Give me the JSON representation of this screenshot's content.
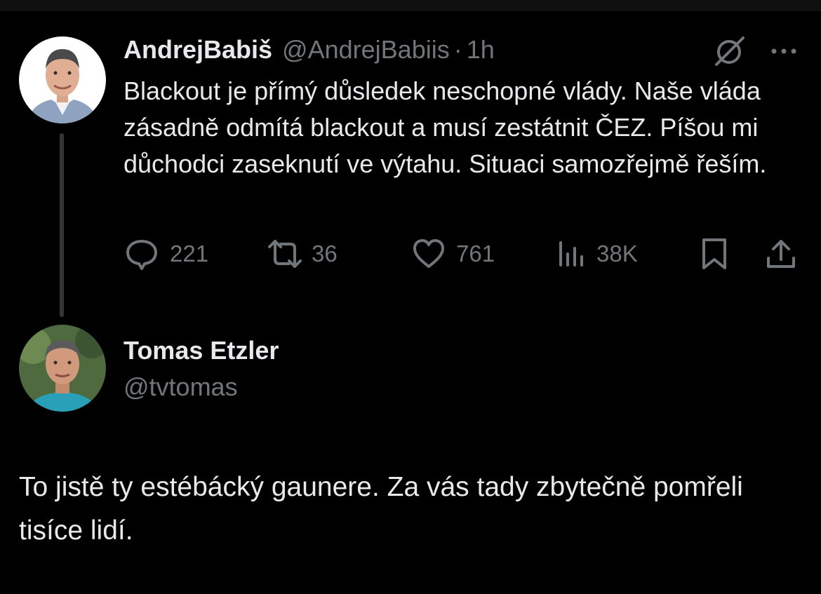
{
  "tweet": {
    "author_name": "AndrejBabiš",
    "author_handle": "@AndrejBabiis",
    "separator": "·",
    "time": "1h",
    "text": "Blackout je přímý důsledek neschopné vlády. Naše vláda zásadně odmítá blackout a musí zestátnit ČEZ. Píšou mi důchodci zaseknutí ve výtahu. Situaci samozřejmě řeším.",
    "stats": {
      "replies": "221",
      "reposts": "36",
      "likes": "761",
      "views": "38K"
    }
  },
  "reply": {
    "author_name": "Tomas Etzler",
    "author_handle": "@tvtomas",
    "text": "To jistě ty estébácký gaunere. Za vás tady zbytečně pomřeli tisíce lidí."
  },
  "icons": {
    "grok": "grok-icon",
    "more": "more-icon",
    "reply": "reply-icon",
    "repost": "repost-icon",
    "like": "heart-icon",
    "views": "views-icon",
    "bookmark": "bookmark-icon",
    "share": "share-icon"
  },
  "colors": {
    "background": "#000000",
    "primary_text": "#e7e9ea",
    "secondary_text": "#71767b",
    "thread_line": "#333639"
  }
}
